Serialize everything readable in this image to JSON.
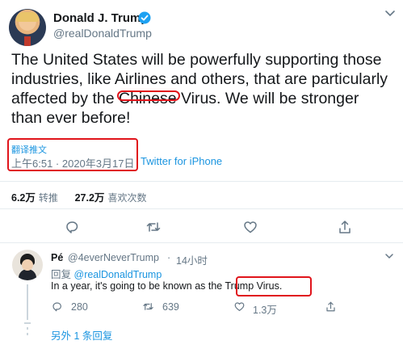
{
  "tweet": {
    "author_name": "Donald J. Trump",
    "author_handle": "@realDonaldTrump",
    "text_before": "The United States will be powerfully supporting those industries, like Airlines and others, that are particularly affected by the ",
    "text_struck": "Chinese",
    "text_after": " Virus. We will be stronger than ever before!",
    "translate_label": "翻译推文",
    "timestamp": "上午6:51 · 2020年3月17日",
    "source": "Twitter for iPhone",
    "retweets_count": "6.2万",
    "retweets_label": "转推",
    "likes_count": "27.2万",
    "likes_label": "喜欢次数"
  },
  "reply": {
    "author_name": "Pé",
    "author_handle": "@4everNeverTrump",
    "separator": "·",
    "time": "14小时",
    "replying_prefix": "回复",
    "replying_to": "@realDonaldTrump",
    "text_before": "In a year, it's going to be known as the ",
    "text_highlight": "Trump Virus.",
    "reply_count": "280",
    "retweet_count": "639",
    "like_count": "1.3万",
    "more_replies": "另外 1 条回复"
  },
  "colors": {
    "accent": "#1b95e0",
    "muted": "#657786",
    "annotation_red": "#e0141b",
    "divider": "#e6ecf0"
  },
  "icons": [
    "verified-badge-icon",
    "chevron-down-icon",
    "reply-icon",
    "retweet-icon",
    "like-icon",
    "share-icon"
  ]
}
